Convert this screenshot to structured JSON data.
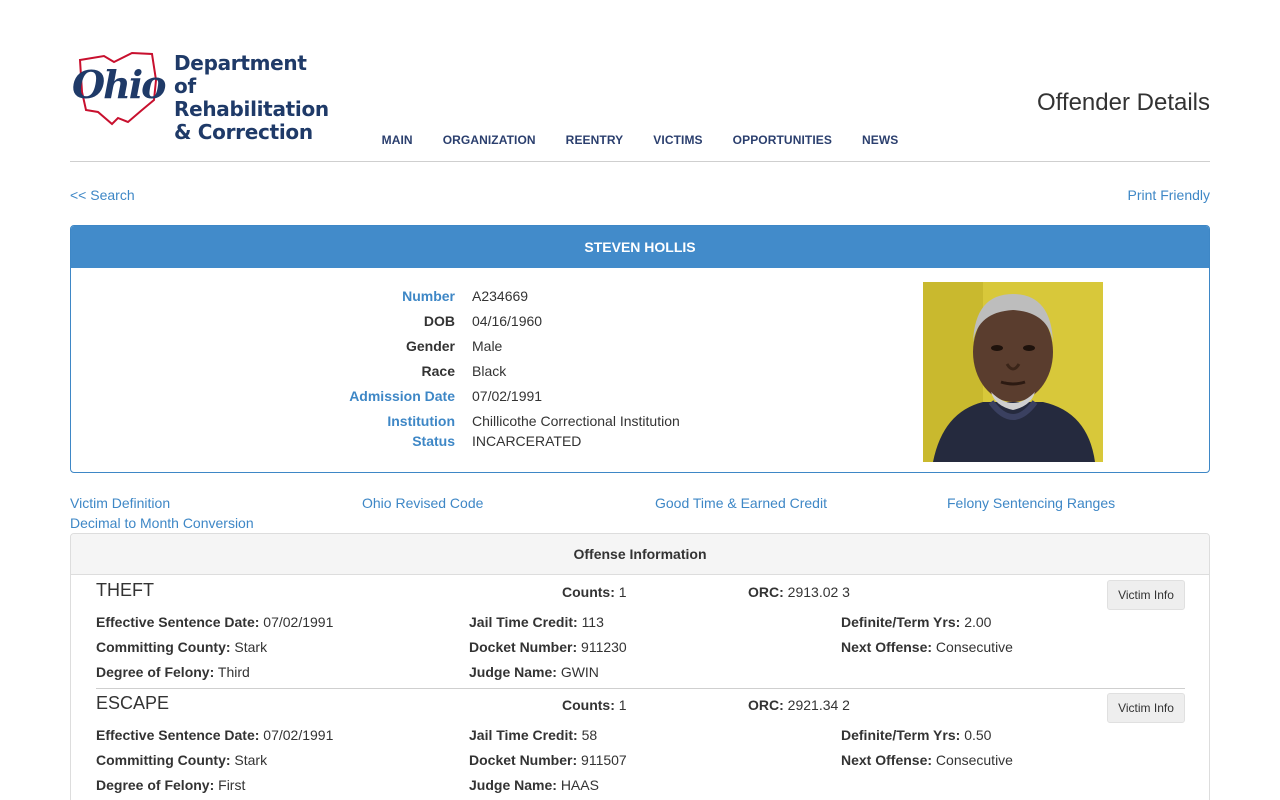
{
  "header": {
    "logo_script": "Ohio",
    "logo_lines": [
      "Department of",
      "Rehabilitation",
      "& Correction"
    ],
    "page_heading": "Offender Details"
  },
  "nav": {
    "items": [
      "MAIN",
      "ORGANIZATION",
      "REENTRY",
      "VICTIMS",
      "OPPORTUNITIES",
      "NEWS"
    ]
  },
  "links": {
    "back": "<< Search",
    "print": "Print Friendly"
  },
  "offender": {
    "name": "STEVEN HOLLIS",
    "fields": [
      {
        "label": "Number",
        "value": "A234669"
      },
      {
        "label": "DOB",
        "value": "04/16/1960"
      },
      {
        "label": "Gender",
        "value": "Male"
      },
      {
        "label": "Race",
        "value": "Black"
      },
      {
        "label": "Admission Date",
        "value": "07/02/1991"
      },
      {
        "label": "Institution",
        "value": "Chillicothe Correctional Institution"
      },
      {
        "label": "Status",
        "value": "INCARCERATED"
      }
    ]
  },
  "resources": [
    "Victim Definition",
    "Ohio Revised Code",
    "Good Time & Earned Credit",
    "Felony Sentencing Ranges",
    "Decimal to Month Conversion"
  ],
  "offense_section": {
    "heading": "Offense Information",
    "labels": {
      "counts": "Counts:",
      "orc": "ORC:",
      "effective": "Effective Sentence Date:",
      "jail": "Jail Time Credit:",
      "term": "Definite/Term Yrs:",
      "county": "Committing County:",
      "docket": "Docket Number:",
      "next": "Next Offense:",
      "degree": "Degree of Felony:",
      "judge": "Judge Name:",
      "button": "Victim Info"
    },
    "records": [
      {
        "title": "THEFT",
        "counts": "1",
        "orc": "2913.02 3",
        "effective": "07/02/1991",
        "jail": "113",
        "term": "2.00",
        "county": "Stark",
        "docket": "911230",
        "next": "Consecutive",
        "degree": "Third",
        "judge": "GWIN"
      },
      {
        "title": "ESCAPE",
        "counts": "1",
        "orc": "2921.34 2",
        "effective": "07/02/1991",
        "jail": "58",
        "term": "0.50",
        "county": "Stark",
        "docket": "911507",
        "next": "Consecutive",
        "degree": "First",
        "judge": "HAAS"
      }
    ]
  },
  "colors": {
    "brand_navy": "#1f3a68",
    "brand_red": "#c8102e",
    "link_blue": "#3e87c6",
    "panel_header": "#428bca"
  }
}
